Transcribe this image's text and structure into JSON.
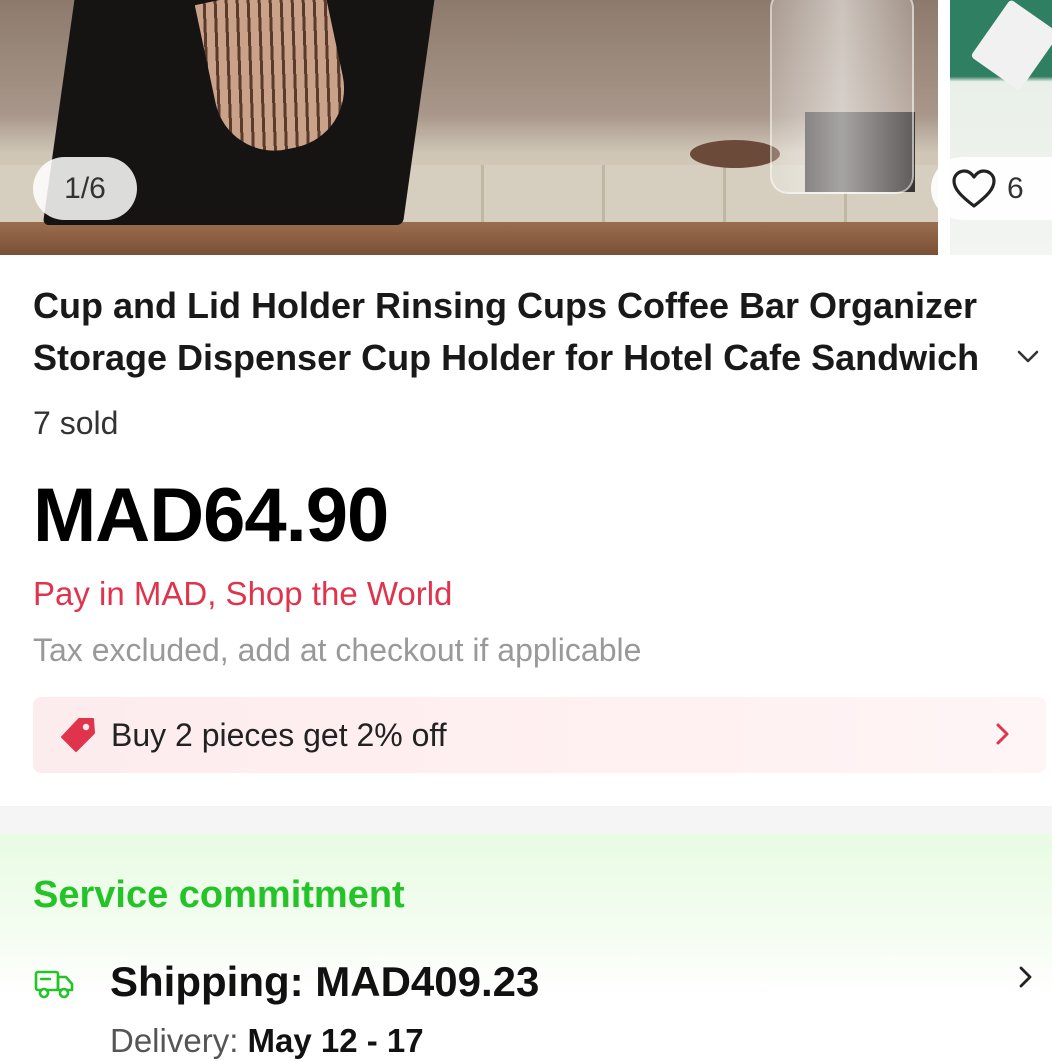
{
  "gallery": {
    "counter": "1/6",
    "wishlist_count": "6"
  },
  "product": {
    "title": "Cup and Lid Holder Rinsing Cups Coffee Bar Organizer Storage Dispenser Cup Holder for Hotel Cafe Sandwich",
    "sold": "7 sold",
    "price": "MAD64.90",
    "pay_line": "Pay in MAD, Shop the World",
    "tax_line": "Tax excluded, add at checkout if applicable"
  },
  "promo": {
    "text": "Buy 2 pieces get 2% off"
  },
  "service": {
    "title": "Service commitment",
    "shipping": "Shipping: MAD409.23",
    "delivery_label": "Delivery: ",
    "delivery_dates": "May 12 - 17"
  },
  "colors": {
    "accent_red": "#e0334c",
    "service_green": "#24c429",
    "promo_bg": "#fdecee"
  },
  "icons": [
    "heart-icon",
    "chevron-down-icon",
    "price-tag-icon",
    "chevron-right-icon",
    "truck-icon"
  ]
}
